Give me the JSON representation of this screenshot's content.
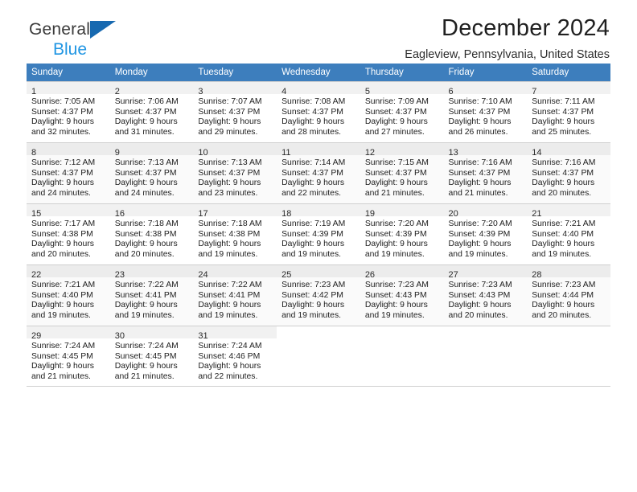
{
  "brand": {
    "line1": "General",
    "line2": "Blue",
    "triangle_color": "#1769b0",
    "line2_color": "#2196e3"
  },
  "header": {
    "title": "December 2024",
    "subtitle": "Eagleview, Pennsylvania, United States"
  },
  "calendar": {
    "header_bg": "#3d7ebd",
    "weekdays": [
      "Sunday",
      "Monday",
      "Tuesday",
      "Wednesday",
      "Thursday",
      "Friday",
      "Saturday"
    ],
    "weeks": [
      [
        {
          "day": "1",
          "sunrise": "Sunrise: 7:05 AM",
          "sunset": "Sunset: 4:37 PM",
          "daylight1": "Daylight: 9 hours",
          "daylight2": "and 32 minutes."
        },
        {
          "day": "2",
          "sunrise": "Sunrise: 7:06 AM",
          "sunset": "Sunset: 4:37 PM",
          "daylight1": "Daylight: 9 hours",
          "daylight2": "and 31 minutes."
        },
        {
          "day": "3",
          "sunrise": "Sunrise: 7:07 AM",
          "sunset": "Sunset: 4:37 PM",
          "daylight1": "Daylight: 9 hours",
          "daylight2": "and 29 minutes."
        },
        {
          "day": "4",
          "sunrise": "Sunrise: 7:08 AM",
          "sunset": "Sunset: 4:37 PM",
          "daylight1": "Daylight: 9 hours",
          "daylight2": "and 28 minutes."
        },
        {
          "day": "5",
          "sunrise": "Sunrise: 7:09 AM",
          "sunset": "Sunset: 4:37 PM",
          "daylight1": "Daylight: 9 hours",
          "daylight2": "and 27 minutes."
        },
        {
          "day": "6",
          "sunrise": "Sunrise: 7:10 AM",
          "sunset": "Sunset: 4:37 PM",
          "daylight1": "Daylight: 9 hours",
          "daylight2": "and 26 minutes."
        },
        {
          "day": "7",
          "sunrise": "Sunrise: 7:11 AM",
          "sunset": "Sunset: 4:37 PM",
          "daylight1": "Daylight: 9 hours",
          "daylight2": "and 25 minutes."
        }
      ],
      [
        {
          "day": "8",
          "sunrise": "Sunrise: 7:12 AM",
          "sunset": "Sunset: 4:37 PM",
          "daylight1": "Daylight: 9 hours",
          "daylight2": "and 24 minutes."
        },
        {
          "day": "9",
          "sunrise": "Sunrise: 7:13 AM",
          "sunset": "Sunset: 4:37 PM",
          "daylight1": "Daylight: 9 hours",
          "daylight2": "and 24 minutes."
        },
        {
          "day": "10",
          "sunrise": "Sunrise: 7:13 AM",
          "sunset": "Sunset: 4:37 PM",
          "daylight1": "Daylight: 9 hours",
          "daylight2": "and 23 minutes."
        },
        {
          "day": "11",
          "sunrise": "Sunrise: 7:14 AM",
          "sunset": "Sunset: 4:37 PM",
          "daylight1": "Daylight: 9 hours",
          "daylight2": "and 22 minutes."
        },
        {
          "day": "12",
          "sunrise": "Sunrise: 7:15 AM",
          "sunset": "Sunset: 4:37 PM",
          "daylight1": "Daylight: 9 hours",
          "daylight2": "and 21 minutes."
        },
        {
          "day": "13",
          "sunrise": "Sunrise: 7:16 AM",
          "sunset": "Sunset: 4:37 PM",
          "daylight1": "Daylight: 9 hours",
          "daylight2": "and 21 minutes."
        },
        {
          "day": "14",
          "sunrise": "Sunrise: 7:16 AM",
          "sunset": "Sunset: 4:37 PM",
          "daylight1": "Daylight: 9 hours",
          "daylight2": "and 20 minutes."
        }
      ],
      [
        {
          "day": "15",
          "sunrise": "Sunrise: 7:17 AM",
          "sunset": "Sunset: 4:38 PM",
          "daylight1": "Daylight: 9 hours",
          "daylight2": "and 20 minutes."
        },
        {
          "day": "16",
          "sunrise": "Sunrise: 7:18 AM",
          "sunset": "Sunset: 4:38 PM",
          "daylight1": "Daylight: 9 hours",
          "daylight2": "and 20 minutes."
        },
        {
          "day": "17",
          "sunrise": "Sunrise: 7:18 AM",
          "sunset": "Sunset: 4:38 PM",
          "daylight1": "Daylight: 9 hours",
          "daylight2": "and 19 minutes."
        },
        {
          "day": "18",
          "sunrise": "Sunrise: 7:19 AM",
          "sunset": "Sunset: 4:39 PM",
          "daylight1": "Daylight: 9 hours",
          "daylight2": "and 19 minutes."
        },
        {
          "day": "19",
          "sunrise": "Sunrise: 7:20 AM",
          "sunset": "Sunset: 4:39 PM",
          "daylight1": "Daylight: 9 hours",
          "daylight2": "and 19 minutes."
        },
        {
          "day": "20",
          "sunrise": "Sunrise: 7:20 AM",
          "sunset": "Sunset: 4:39 PM",
          "daylight1": "Daylight: 9 hours",
          "daylight2": "and 19 minutes."
        },
        {
          "day": "21",
          "sunrise": "Sunrise: 7:21 AM",
          "sunset": "Sunset: 4:40 PM",
          "daylight1": "Daylight: 9 hours",
          "daylight2": "and 19 minutes."
        }
      ],
      [
        {
          "day": "22",
          "sunrise": "Sunrise: 7:21 AM",
          "sunset": "Sunset: 4:40 PM",
          "daylight1": "Daylight: 9 hours",
          "daylight2": "and 19 minutes."
        },
        {
          "day": "23",
          "sunrise": "Sunrise: 7:22 AM",
          "sunset": "Sunset: 4:41 PM",
          "daylight1": "Daylight: 9 hours",
          "daylight2": "and 19 minutes."
        },
        {
          "day": "24",
          "sunrise": "Sunrise: 7:22 AM",
          "sunset": "Sunset: 4:41 PM",
          "daylight1": "Daylight: 9 hours",
          "daylight2": "and 19 minutes."
        },
        {
          "day": "25",
          "sunrise": "Sunrise: 7:23 AM",
          "sunset": "Sunset: 4:42 PM",
          "daylight1": "Daylight: 9 hours",
          "daylight2": "and 19 minutes."
        },
        {
          "day": "26",
          "sunrise": "Sunrise: 7:23 AM",
          "sunset": "Sunset: 4:43 PM",
          "daylight1": "Daylight: 9 hours",
          "daylight2": "and 19 minutes."
        },
        {
          "day": "27",
          "sunrise": "Sunrise: 7:23 AM",
          "sunset": "Sunset: 4:43 PM",
          "daylight1": "Daylight: 9 hours",
          "daylight2": "and 20 minutes."
        },
        {
          "day": "28",
          "sunrise": "Sunrise: 7:23 AM",
          "sunset": "Sunset: 4:44 PM",
          "daylight1": "Daylight: 9 hours",
          "daylight2": "and 20 minutes."
        }
      ],
      [
        {
          "day": "29",
          "sunrise": "Sunrise: 7:24 AM",
          "sunset": "Sunset: 4:45 PM",
          "daylight1": "Daylight: 9 hours",
          "daylight2": "and 21 minutes."
        },
        {
          "day": "30",
          "sunrise": "Sunrise: 7:24 AM",
          "sunset": "Sunset: 4:45 PM",
          "daylight1": "Daylight: 9 hours",
          "daylight2": "and 21 minutes."
        },
        {
          "day": "31",
          "sunrise": "Sunrise: 7:24 AM",
          "sunset": "Sunset: 4:46 PM",
          "daylight1": "Daylight: 9 hours",
          "daylight2": "and 22 minutes."
        },
        {
          "day": "",
          "sunrise": "",
          "sunset": "",
          "daylight1": "",
          "daylight2": ""
        },
        {
          "day": "",
          "sunrise": "",
          "sunset": "",
          "daylight1": "",
          "daylight2": ""
        },
        {
          "day": "",
          "sunrise": "",
          "sunset": "",
          "daylight1": "",
          "daylight2": ""
        },
        {
          "day": "",
          "sunrise": "",
          "sunset": "",
          "daylight1": "",
          "daylight2": ""
        }
      ]
    ]
  }
}
